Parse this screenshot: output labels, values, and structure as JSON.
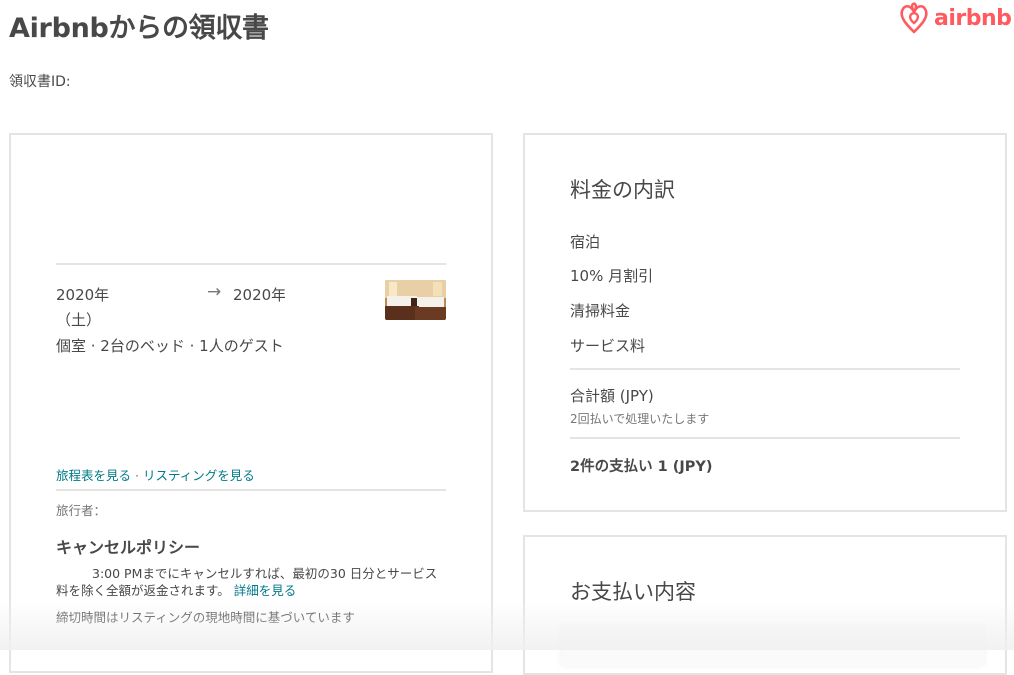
{
  "header": {
    "title": "Airbnbからの領収書",
    "logo_text": "airbnb",
    "receipt_id_label": "領収書ID:"
  },
  "reservation": {
    "check_in_date": "2020年",
    "check_in_weekday": "（土）",
    "check_out_date": "2020年",
    "room_description": "個室 · 2台のベッド · 1人のゲスト",
    "itinerary_link": "旅程表を見る",
    "link_separator": "·",
    "listing_link": "リスティングを見る",
    "traveler_label": "旅行者：",
    "cancellation_title": "キャンセルポリシー",
    "cancellation_text": "3:00 PMまでにキャンセルすれば、最初の30 日分とサービス料を除く全額が返金されます。",
    "details_link": "詳細を見る",
    "cutoff_note": "締切時間はリスティングの現地時間に基づいています"
  },
  "price_breakdown": {
    "title": "料金の内訳",
    "items": [
      "宿泊",
      "10% 月割引",
      "清掃料金",
      "サービス料"
    ],
    "total_label": "合計額 (JPY)",
    "total_note": "2回払いで処理いたします",
    "installments_label": "2件の支払い 1 (JPY)"
  },
  "payment": {
    "title": "お支払い内容"
  },
  "colors": {
    "brand": "#FF5A5F",
    "link": "#007A87",
    "text": "#484848",
    "muted": "#767676",
    "border": "#e4e4e4"
  },
  "icons": {
    "logo": "airbnb-belo-icon",
    "arrow": "right-arrow-icon"
  }
}
